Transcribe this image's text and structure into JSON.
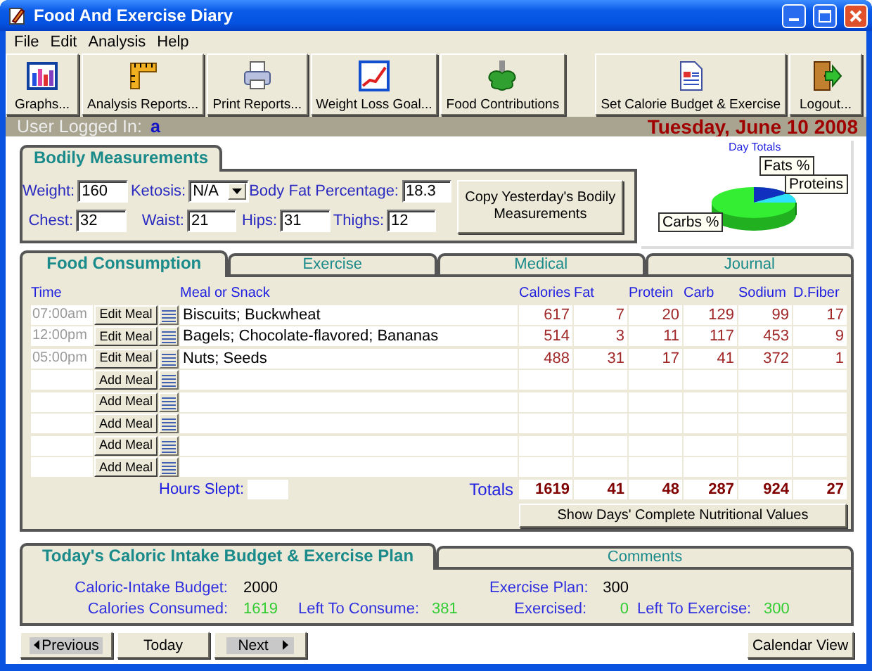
{
  "window": {
    "title": "Food And Exercise Diary"
  },
  "menu": [
    "File",
    "Edit",
    "Analysis",
    "Help"
  ],
  "toolbar": [
    {
      "label": "Graphs..."
    },
    {
      "label": "Analysis Reports..."
    },
    {
      "label": "Print Reports..."
    },
    {
      "label": "Weight Loss Goal..."
    },
    {
      "label": "Food Contributions"
    },
    {
      "label": "Set Calorie Budget & Exercise"
    },
    {
      "label": "Logout..."
    }
  ],
  "user_bar": {
    "label": "User Logged In:",
    "user": "a",
    "date": "Tuesday, June 10 2008"
  },
  "measurements": {
    "tab": "Bodily Measurements",
    "rows": [
      [
        {
          "label": "Weight:",
          "value": "160",
          "kind": "text"
        },
        {
          "label": "Ketosis:",
          "value": "N/A",
          "kind": "dropdown"
        },
        {
          "label": "Body Fat Percentage:",
          "value": "18.3",
          "kind": "text"
        }
      ],
      [
        {
          "label": "Chest:",
          "value": "32",
          "kind": "text"
        },
        {
          "label": "Waist:",
          "value": "21",
          "kind": "text"
        },
        {
          "label": "Hips:",
          "value": "31",
          "kind": "text"
        },
        {
          "label": "Thighs:",
          "value": "12",
          "kind": "text"
        }
      ]
    ],
    "button": "Copy Yesterday's Bodily Measurements"
  },
  "day_totals": {
    "title": "Day Totals",
    "labels": [
      "Fats %",
      "Proteins",
      "Carbs %"
    ]
  },
  "food": {
    "tabs": [
      {
        "label": "Food Consumption",
        "selected": true
      },
      {
        "label": "Exercise",
        "selected": false
      },
      {
        "label": "Medical",
        "selected": false
      },
      {
        "label": "Journal",
        "selected": false
      }
    ],
    "columns": [
      "Time",
      "Meal or Snack",
      "Calories",
      "Fat",
      "Protein",
      "Carb",
      "Sodium",
      "D.Fiber"
    ],
    "rows": [
      {
        "time": "07:00am",
        "button": "Edit Meal",
        "meal": "Biscuits; Buckwheat",
        "values": [
          "617",
          "7",
          "20",
          "129",
          "99",
          "17"
        ]
      },
      {
        "time": "12:00pm",
        "button": "Edit Meal",
        "meal": "Bagels; Chocolate-flavored; Bananas",
        "values": [
          "514",
          "3",
          "11",
          "117",
          "453",
          "9"
        ]
      },
      {
        "time": "05:00pm",
        "button": "Edit Meal",
        "meal": "Nuts; Seeds",
        "values": [
          "488",
          "31",
          "17",
          "41",
          "372",
          "1"
        ]
      },
      {
        "button": "Add Meal"
      },
      {
        "button": "Add Meal"
      },
      {
        "button": "Add Meal"
      },
      {
        "button": "Add Meal"
      },
      {
        "button": "Add Meal"
      }
    ],
    "hours_slept": {
      "label": "Hours Slept:"
    },
    "totals": {
      "label": "Totals",
      "values": [
        "1619",
        "41",
        "48",
        "287",
        "924",
        "27"
      ]
    },
    "button": "Show Days' Complete Nutritional Values"
  },
  "budget": {
    "tabs": [
      {
        "label": "Today's Caloric Intake Budget & Exercise Plan",
        "selected": true
      },
      {
        "label": "Comments",
        "selected": false
      }
    ],
    "intake": [
      {
        "label": "Caloric-Intake Budget:",
        "value": "2000",
        "color": "#000000"
      },
      {
        "label": "Calories Consumed:",
        "value": "1619",
        "color": "#33cc33"
      },
      {
        "label": "Left To Consume:",
        "value": "381",
        "color": "#33cc33"
      }
    ],
    "exercise": [
      {
        "label": "Exercise Plan:",
        "value": "300",
        "color": "#000000"
      },
      {
        "label": "Exercised:",
        "value": "0",
        "color": "#33cc33"
      },
      {
        "label": "Left To Exercise:",
        "value": "300",
        "color": "#33cc33"
      }
    ]
  },
  "nav": [
    {
      "label": "Previous",
      "kind": "prev"
    },
    {
      "label": "Today",
      "kind": "plain"
    },
    {
      "label": "Next",
      "kind": "next"
    },
    {
      "label": "Calendar View",
      "kind": "plain"
    }
  ]
}
